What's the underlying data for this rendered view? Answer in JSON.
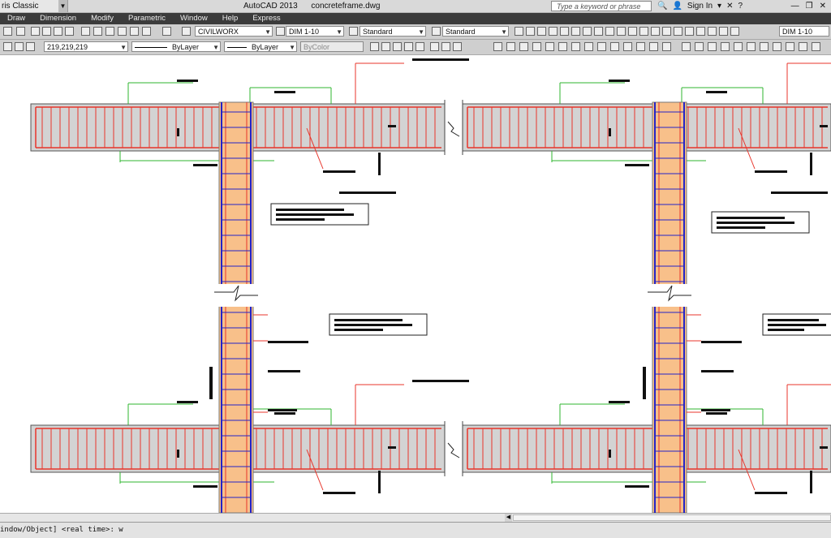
{
  "window": {
    "workspace": "ris Classic Templa...",
    "app_title": "AutoCAD 2013",
    "file_name": "concreteframe.dwg",
    "search_placeholder": "Type a keyword or phrase",
    "sign_in": "Sign In"
  },
  "menu": [
    "Draw",
    "Dimension",
    "Modify",
    "Parametric",
    "Window",
    "Help",
    "Express"
  ],
  "toolbar1": {
    "text_style": "CIVILWORX",
    "dim_style": "DIM 1-10",
    "table_style": "Standard",
    "multileader_style": "Standard",
    "dim_style_right": "DIM 1-10"
  },
  "toolbar2": {
    "color": "219,219,219",
    "linetype": "ByLayer",
    "lineweight": "ByLayer",
    "plot_style": "ByColor"
  },
  "command_line": "indow/Object] <real time>: w",
  "colors": {
    "beam_fill": "#d3d3d3",
    "column_fill": "#f8c08a",
    "rebar_red": "#e8352b",
    "stirrup_blue": "#2323c8",
    "dim_green": "#2fb52f",
    "menubar": "#3b3b3b"
  }
}
